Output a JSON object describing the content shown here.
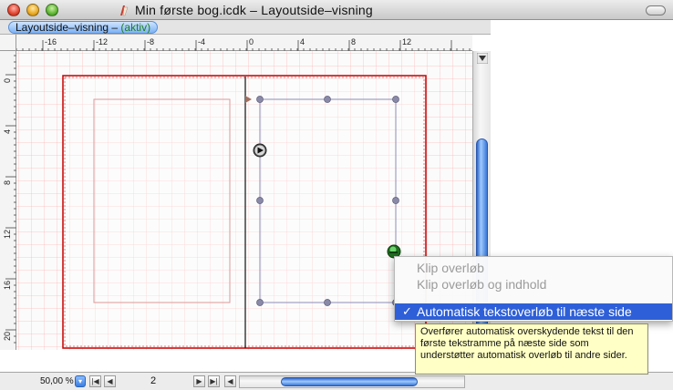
{
  "window": {
    "title": "Min første bog.icdk – Layoutside–visning"
  },
  "mode_bar": {
    "label": "Layoutside–visning – ",
    "state": "(aktiv)"
  },
  "ruler": {
    "horizontal_ticks": [
      "-16",
      "-12",
      "-8",
      "-4",
      "0",
      "4",
      "8",
      "12"
    ],
    "vertical_ticks": [
      "0",
      "4",
      "8",
      "12",
      "16",
      "20"
    ]
  },
  "bottom_bar": {
    "zoom_value": "50,00 %",
    "page_number": "2"
  },
  "context_menu": {
    "items": [
      {
        "label": "Klip overløb",
        "enabled": false,
        "checked": false
      },
      {
        "label": "Klip overløb og indhold",
        "enabled": false,
        "checked": false
      },
      {
        "label": "Automatisk tekstoverløb til næste side",
        "enabled": true,
        "checked": true
      }
    ],
    "check_glyph": "✓"
  },
  "tooltip": {
    "text": "Overfører automatisk overskydende tekst til den første tekstramme på næste side som understøtter automatisk overløb til andre sider."
  },
  "colors": {
    "selection": "#2e5fd8",
    "page_border": "#c40000",
    "grid": "#ffb0b0",
    "frame_outline": "#8c8cb8"
  },
  "icons": {
    "close": "close-icon",
    "minimize": "minimize-icon",
    "zoom": "zoom-icon",
    "document": "document-icon",
    "toolbar": "toolbar-toggle-icon"
  }
}
